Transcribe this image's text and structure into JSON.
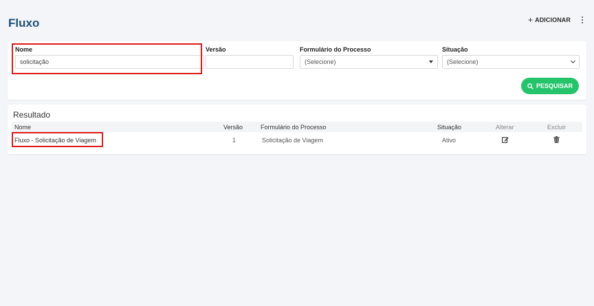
{
  "header": {
    "title": "Fluxo",
    "add_label": "ADICIONAR",
    "add_icon": "plus-icon",
    "menu_icon": "kebab-menu-icon"
  },
  "filters": {
    "nome": {
      "label": "Nome",
      "value": "solicitação"
    },
    "versao": {
      "label": "Versão",
      "value": ""
    },
    "formulario": {
      "label": "Formulário do Processo",
      "selected": "(Selecione)"
    },
    "situacao": {
      "label": "Situação",
      "selected": "(Selecione)"
    },
    "search_button": "PESQUISAR",
    "search_icon": "search-icon"
  },
  "results": {
    "title": "Resultado",
    "columns": {
      "nome": "Nome",
      "versao": "Versão",
      "formulario": "Formulário do Processo",
      "situacao": "Situação",
      "alterar": "Alterar",
      "excluir": "Excluir"
    },
    "rows": [
      {
        "nome": "Fluxo - Solicitação de Viagem",
        "versao": "1",
        "formulario": "Solicitação de Viagem",
        "situacao": "Ativo",
        "edit_icon": "edit-icon",
        "delete_icon": "trash-icon"
      }
    ]
  },
  "colors": {
    "title": "#1f4e79",
    "highlight": "#e01818",
    "primary_button": "#25c46b",
    "background": "#f4f5f8"
  }
}
